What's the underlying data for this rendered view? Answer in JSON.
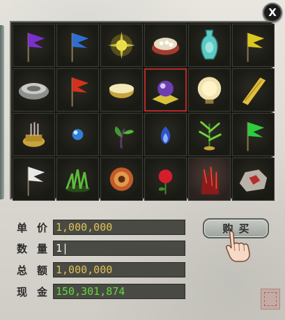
{
  "shop": {
    "close_label": "X",
    "items": [
      {
        "icon": "purple-flag-icon"
      },
      {
        "icon": "blue-flag-icon"
      },
      {
        "icon": "golden-star-burst-icon"
      },
      {
        "icon": "pearl-basket-icon"
      },
      {
        "icon": "jade-vase-icon"
      },
      {
        "icon": "yellow-flag-icon"
      },
      {
        "icon": "silver-bowl-icon"
      },
      {
        "icon": "red-flag-icon"
      },
      {
        "icon": "rice-bowl-icon"
      },
      {
        "icon": "crystal-orb-icon",
        "selected": true
      },
      {
        "icon": "lantern-icon"
      },
      {
        "icon": "yellow-scroll-icon"
      },
      {
        "icon": "incense-burner-icon"
      },
      {
        "icon": "blue-pearl-icon"
      },
      {
        "icon": "herb-sprout-icon"
      },
      {
        "icon": "blue-flame-icon"
      },
      {
        "icon": "bamboo-plant-icon"
      },
      {
        "icon": "green-flag-icon"
      },
      {
        "icon": "white-flag-icon"
      },
      {
        "icon": "green-grass-icon"
      },
      {
        "icon": "flower-disc-icon"
      },
      {
        "icon": "red-rose-icon"
      },
      {
        "icon": "red-crystal-cluster-icon",
        "highlighted": true
      },
      {
        "icon": "ore-rock-icon"
      }
    ],
    "unit_price_label": "单价",
    "unit_price": "1,000,000",
    "quantity_label": "数量",
    "quantity": "1",
    "total_label": "总额",
    "total": "1,000,000",
    "cash_label": "现金",
    "cash": "150,301,874",
    "buy_label": "购买"
  },
  "colors": {
    "price_text": "#e2c253",
    "cash_text": "#5fdc3c",
    "selected_border": "#b52a2a"
  }
}
